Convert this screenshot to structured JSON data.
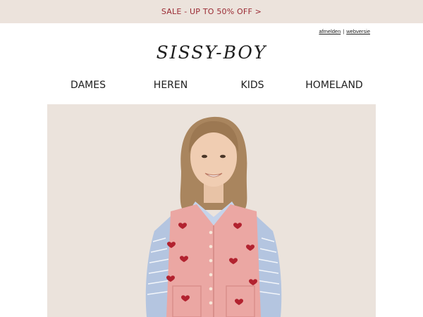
{
  "promo": {
    "text": "SALE - UP TO 50% OFF >"
  },
  "utility": {
    "unsubscribe": "afmelden",
    "separator": "|",
    "web_version": "webversie"
  },
  "brand": {
    "logo_text": "SISSY-BOY"
  },
  "nav": {
    "items": [
      "DAMES",
      "HEREN",
      "KIDS",
      "HOMELAND"
    ]
  },
  "hero": {
    "image": "child-in-pink-heart-knit-vest"
  },
  "colors": {
    "promo_bg": "#ece3dc",
    "promo_text": "#9a2a33",
    "hero_bg": "#ebe3dc"
  }
}
